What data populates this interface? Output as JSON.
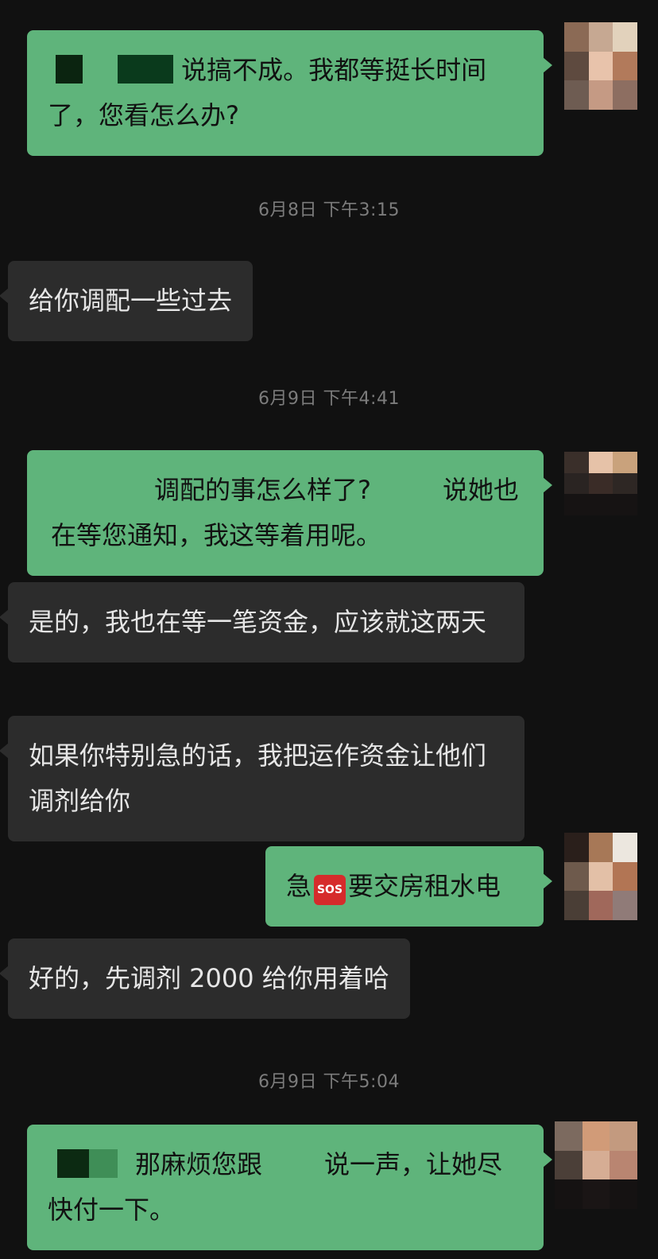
{
  "messages": [
    {
      "id": "m1",
      "side": "right",
      "text_a": "说搞不成。我都等挺长时间了，您看怎么办?"
    },
    {
      "id": "t1",
      "type": "time",
      "text": "6月8日 下午3:15"
    },
    {
      "id": "m2",
      "side": "left",
      "text": "给你调配一些过去"
    },
    {
      "id": "t2",
      "type": "time",
      "text": "6月9日 下午4:41"
    },
    {
      "id": "m3",
      "side": "right",
      "text_a": "调配的事怎么样了?",
      "text_b": "说她也在等您通知，我这等着用呢。"
    },
    {
      "id": "m4",
      "side": "left",
      "text": "是的，我也在等一笔资金，应该就这两天"
    },
    {
      "id": "m5",
      "side": "left",
      "text": "如果你特别急的话，我把运作资金让他们调剂给你"
    },
    {
      "id": "m6",
      "side": "right",
      "text_a": "急",
      "emoji": "SOS",
      "text_b": "要交房租水电"
    },
    {
      "id": "m7",
      "side": "left",
      "text": "好的，先调剂 2000 给你用着哈"
    },
    {
      "id": "t3",
      "type": "time",
      "text": "6月9日 下午5:04"
    },
    {
      "id": "m8",
      "side": "right",
      "text_a": "那麻烦您跟",
      "text_b": "说一声，让她尽快付一下。"
    }
  ],
  "colors": {
    "background": "#111111",
    "outgoing_bubble": "#5FB47B",
    "incoming_bubble": "#2C2C2C",
    "timestamp": "#7C7C7C"
  }
}
